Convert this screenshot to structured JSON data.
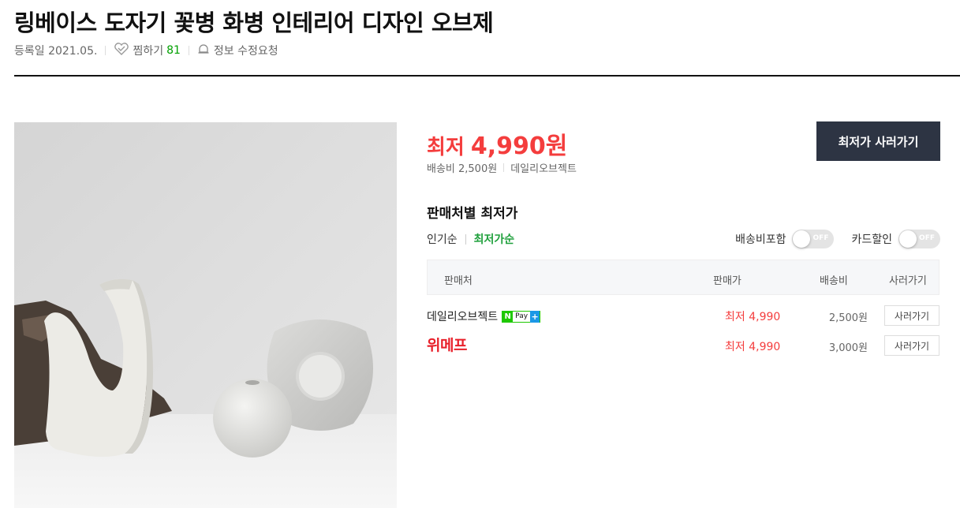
{
  "product": {
    "title": "링베이스 도자기 꽃병 화병 인테리어 디자인 오브제",
    "registered": "등록일 2021.05.",
    "zzim_label": "찜하기",
    "zzim_count": "81",
    "edit_label": "정보 수정요청"
  },
  "summary": {
    "lowest_label": "최저",
    "lowest_price": "4,990원",
    "shipping": "배송비 2,500원",
    "seller": "데일리오브젝트",
    "buy_button": "최저가 사러가기"
  },
  "compare": {
    "title": "판매처별 최저가",
    "sort_options": [
      "인기순",
      "최저가순"
    ],
    "active_sort": "최저가순",
    "filters": [
      {
        "label": "배송비포함",
        "state": "OFF"
      },
      {
        "label": "카드할인",
        "state": "OFF"
      }
    ],
    "columns": [
      "판매처",
      "판매가",
      "배송비",
      "사러가기"
    ],
    "rows": [
      {
        "seller": "데일리오브젝트",
        "badge": {
          "n": "N",
          "pay": "Pay",
          "plus": "+"
        },
        "price": "최저 4,990",
        "shipping": "2,500원",
        "action": "사러가기"
      },
      {
        "seller": "위메프",
        "price": "최저 4,990",
        "shipping": "3,000원",
        "action": "사러가기"
      }
    ]
  },
  "colors": {
    "accent_red": "#f43d3d",
    "active_green": "#1fa03c",
    "button_dark": "#2d3443",
    "npay_green": "#1ec800",
    "wemakeprice_red": "#e8202a"
  },
  "icons": {
    "zzim": "heart-icon",
    "edit": "bell-icon"
  }
}
